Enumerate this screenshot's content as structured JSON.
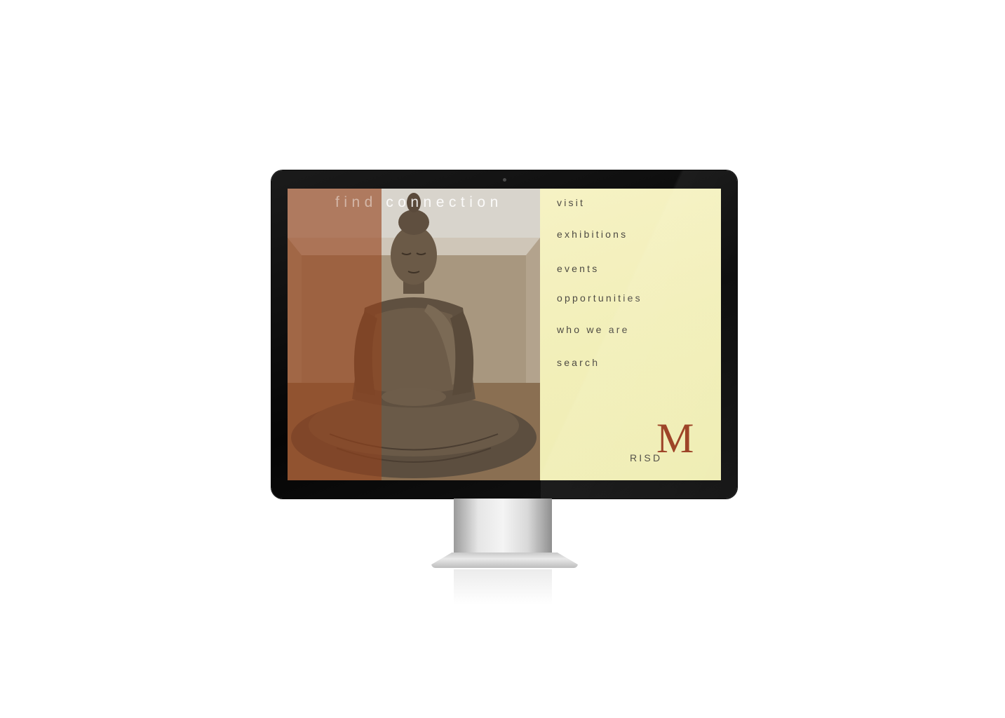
{
  "hero": {
    "title_word1": "find",
    "title_word2": "connection",
    "image_subject": "seated-buddha-statue"
  },
  "nav": {
    "items": [
      {
        "label": "visit"
      },
      {
        "label": "exhibitions"
      },
      {
        "label": "events"
      },
      {
        "label": "opportunities"
      },
      {
        "label": "who we are"
      },
      {
        "label": "search"
      }
    ]
  },
  "logo": {
    "letter": "M",
    "wordmark": "RISD"
  },
  "colors": {
    "nav_background": "#f1efb6",
    "accent_rust": "#9a3d20",
    "text": "#4d4a43"
  }
}
